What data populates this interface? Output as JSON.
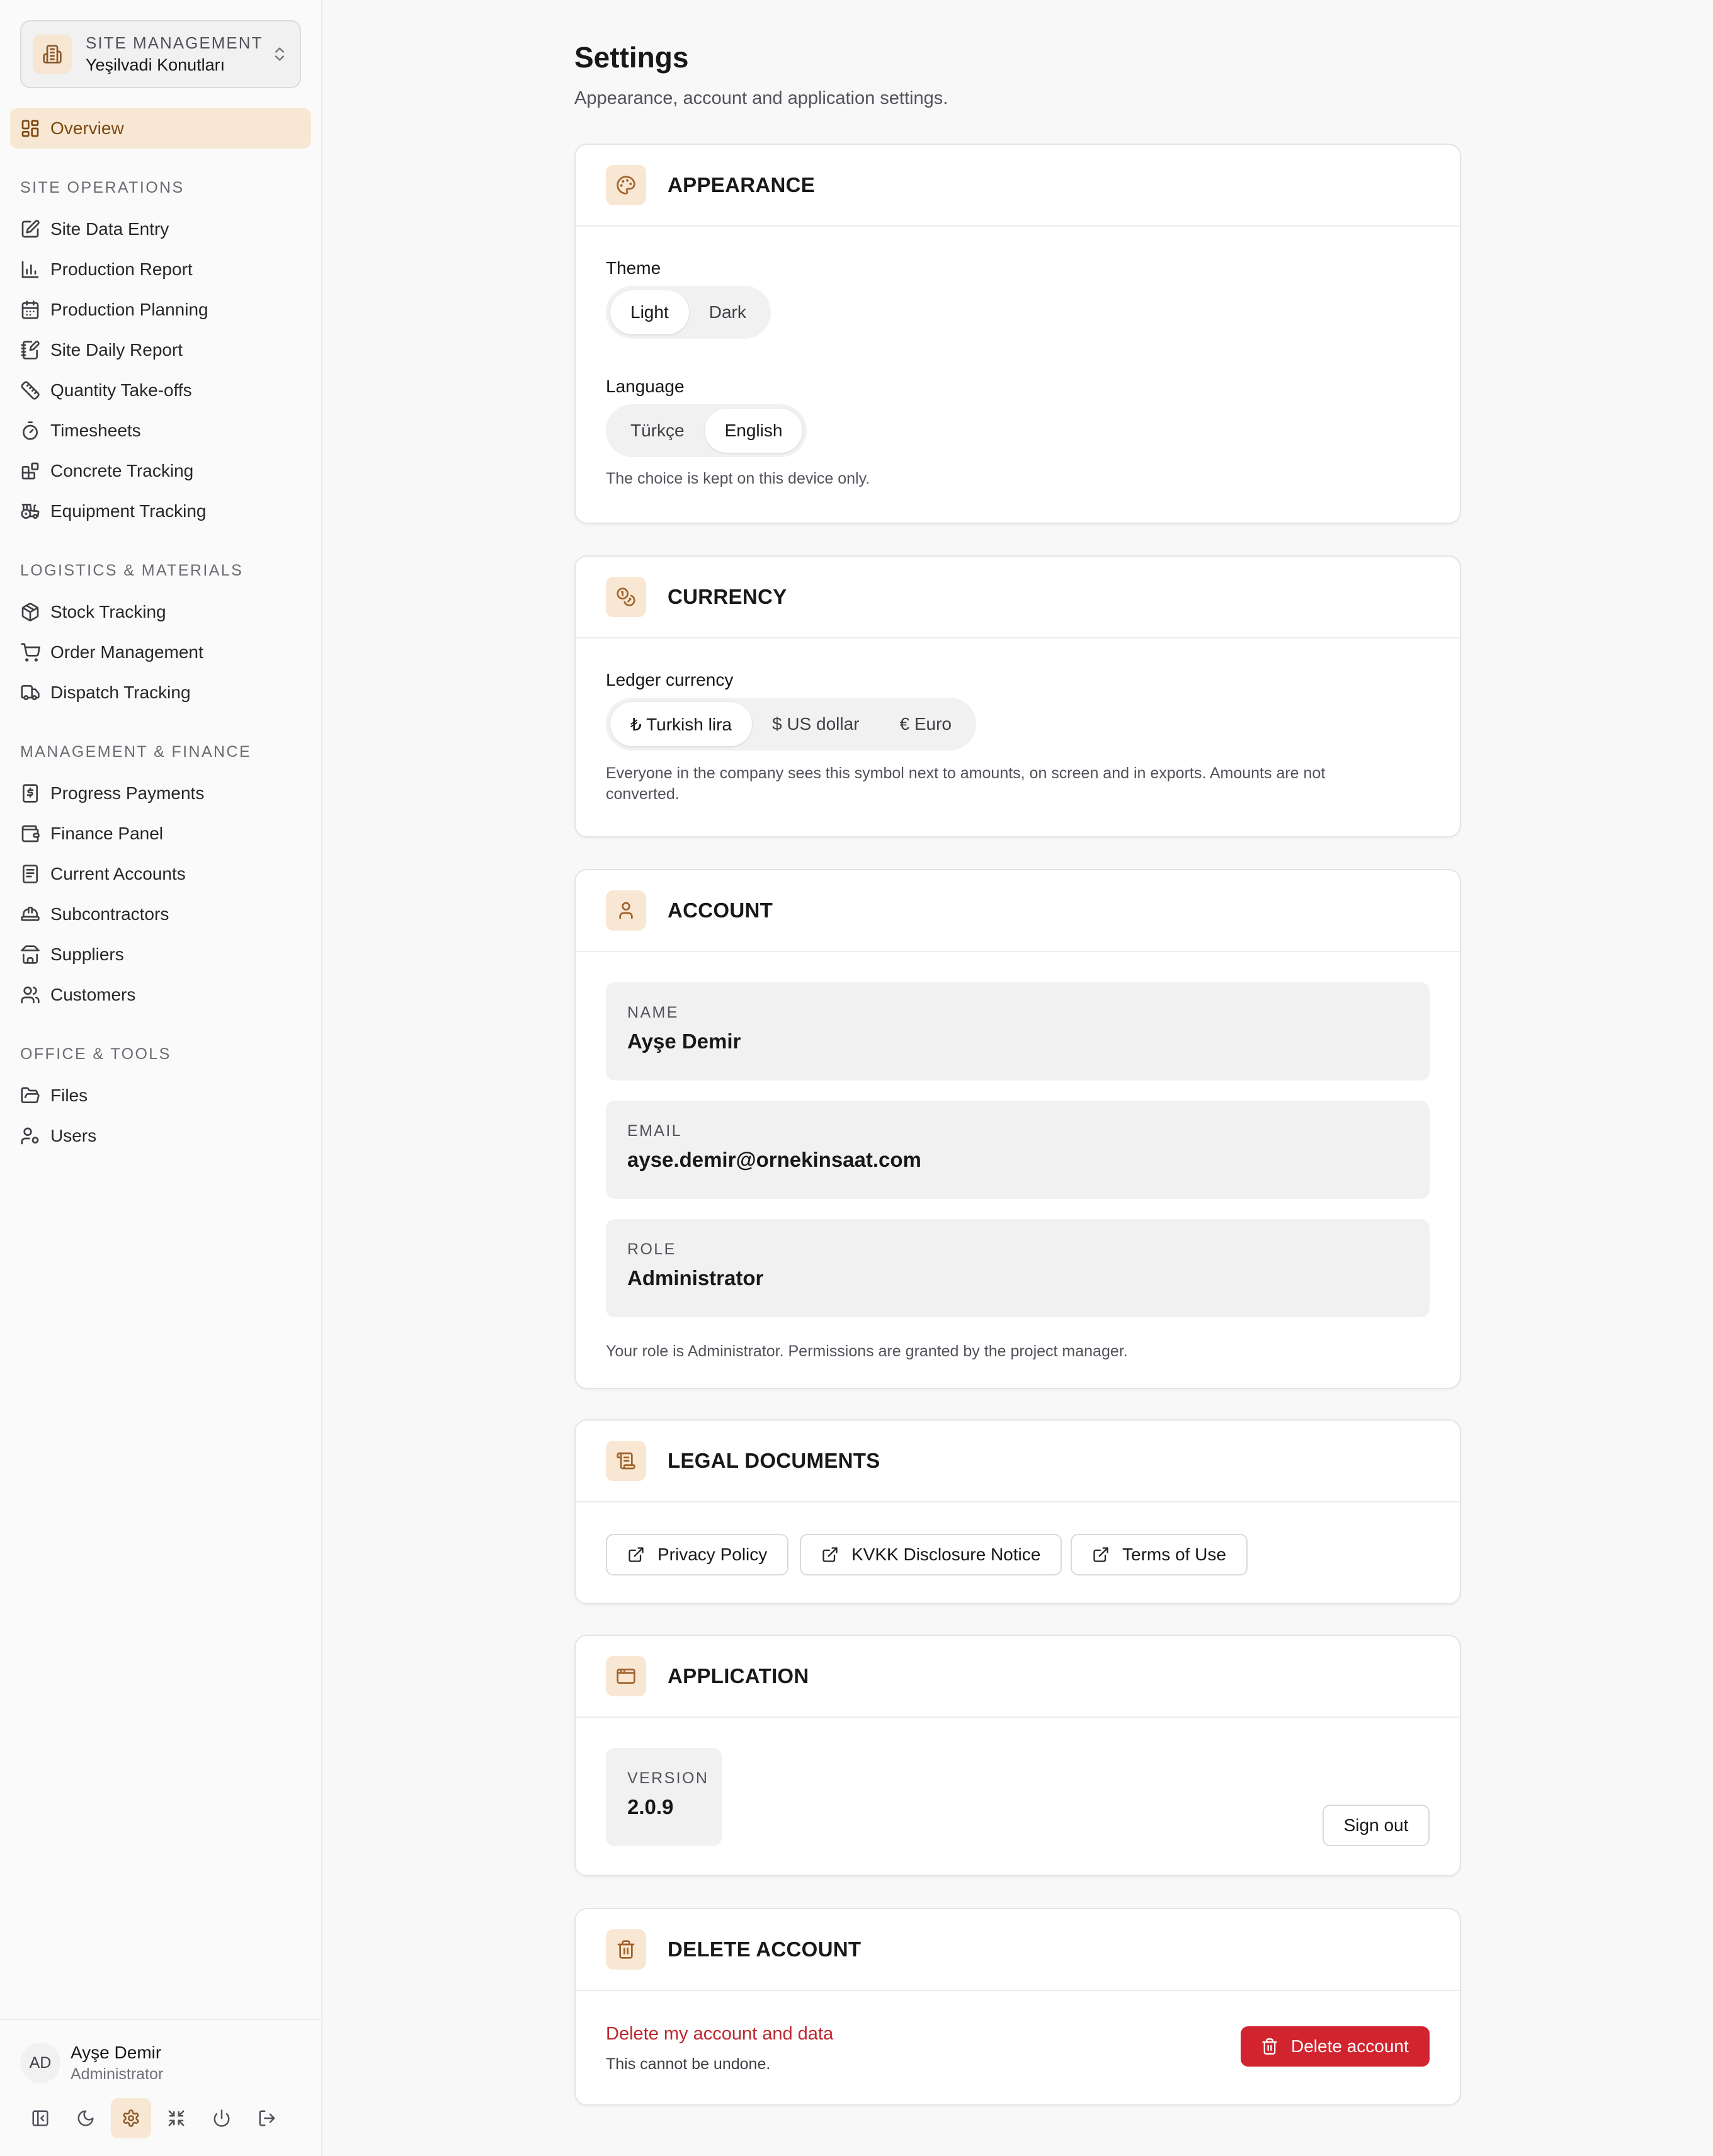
{
  "sidebar": {
    "site_kicker": "SITE MANAGEMENT",
    "site_name": "Yeşilvadi Konutları",
    "overview": "Overview",
    "sections": [
      {
        "title": "SITE OPERATIONS",
        "items": [
          "Site Data Entry",
          "Production Report",
          "Production Planning",
          "Site Daily Report",
          "Quantity Take-offs",
          "Timesheets",
          "Concrete Tracking",
          "Equipment Tracking"
        ]
      },
      {
        "title": "LOGISTICS & MATERIALS",
        "items": [
          "Stock Tracking",
          "Order Management",
          "Dispatch Tracking"
        ]
      },
      {
        "title": "MANAGEMENT & FINANCE",
        "items": [
          "Progress Payments",
          "Finance Panel",
          "Current Accounts",
          "Subcontractors",
          "Suppliers",
          "Customers"
        ]
      },
      {
        "title": "OFFICE & TOOLS",
        "items": [
          "Files",
          "Users"
        ]
      }
    ],
    "user": {
      "initials": "AD",
      "name": "Ayşe Demir",
      "role": "Administrator"
    }
  },
  "page": {
    "title": "Settings",
    "subtitle": "Appearance, account and application settings."
  },
  "appearance": {
    "title": "APPEARANCE",
    "theme_label": "Theme",
    "theme_options": [
      "Light",
      "Dark"
    ],
    "theme_selected": "Light",
    "language_label": "Language",
    "language_options": [
      "Türkçe",
      "English"
    ],
    "language_selected": "English",
    "hint": "The choice is kept on this device only."
  },
  "currency": {
    "title": "CURRENCY",
    "label": "Ledger currency",
    "options": [
      "₺ Turkish lira",
      "$ US dollar",
      "€ Euro"
    ],
    "selected": "₺ Turkish lira",
    "hint": "Everyone in the company sees this symbol next to amounts, on screen and in exports. Amounts are not converted."
  },
  "account": {
    "title": "ACCOUNT",
    "name_label": "NAME",
    "name_value": "Ayşe Demir",
    "email_label": "EMAIL",
    "email_value": "ayse.demir@ornekinsaat.com",
    "role_label": "ROLE",
    "role_value": "Administrator",
    "hint": "Your role is Administrator. Permissions are granted by the project manager."
  },
  "legal": {
    "title": "LEGAL DOCUMENTS",
    "links": [
      "Privacy Policy",
      "KVKK Disclosure Notice",
      "Terms of Use"
    ]
  },
  "application": {
    "title": "APPLICATION",
    "version_label": "VERSION",
    "version_value": "2.0.9",
    "sign_out": "Sign out"
  },
  "delete_account": {
    "title": "DELETE ACCOUNT",
    "heading": "Delete my account and data",
    "subtext": "This cannot be undone.",
    "button": "Delete account"
  },
  "colors": {
    "accent_bg": "#f8e7d3",
    "accent_fg": "#7c4a15",
    "danger": "#d1242f"
  }
}
